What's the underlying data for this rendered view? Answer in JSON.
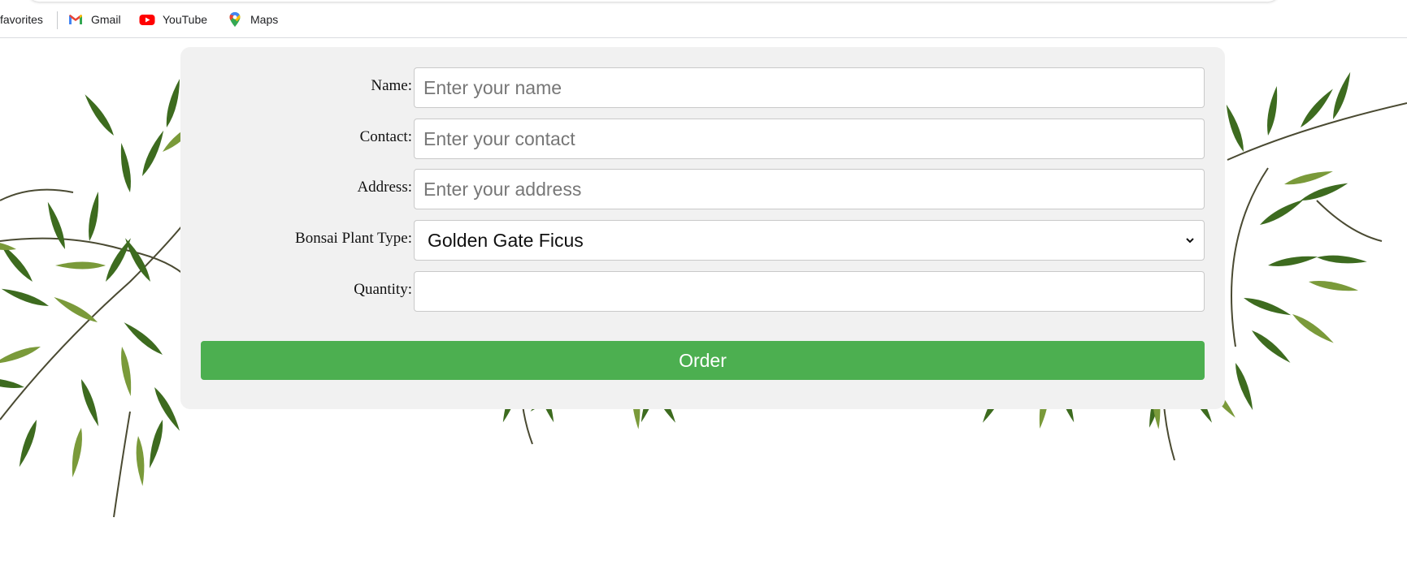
{
  "bookmarks_bar": {
    "items": [
      {
        "label": "favorites",
        "icon": "none"
      },
      {
        "label": "Gmail",
        "icon": "gmail-icon"
      },
      {
        "label": "YouTube",
        "icon": "youtube-icon"
      },
      {
        "label": "Maps",
        "icon": "maps-icon"
      }
    ]
  },
  "form": {
    "name": {
      "label": "Name:",
      "placeholder": "Enter your name",
      "value": ""
    },
    "contact": {
      "label": "Contact:",
      "placeholder": "Enter your contact",
      "value": ""
    },
    "address": {
      "label": "Address:",
      "placeholder": "Enter your address",
      "value": ""
    },
    "plant_type": {
      "label": "Bonsai Plant Type:",
      "selected": "Golden Gate Ficus"
    },
    "quantity": {
      "label": "Quantity:",
      "value": ""
    },
    "submit_label": "Order"
  },
  "colors": {
    "card_background": "#f1f1f1",
    "order_button": "#4caf50",
    "leaf_dark": "#3d6b1f",
    "leaf_light": "#7a9a3a"
  }
}
